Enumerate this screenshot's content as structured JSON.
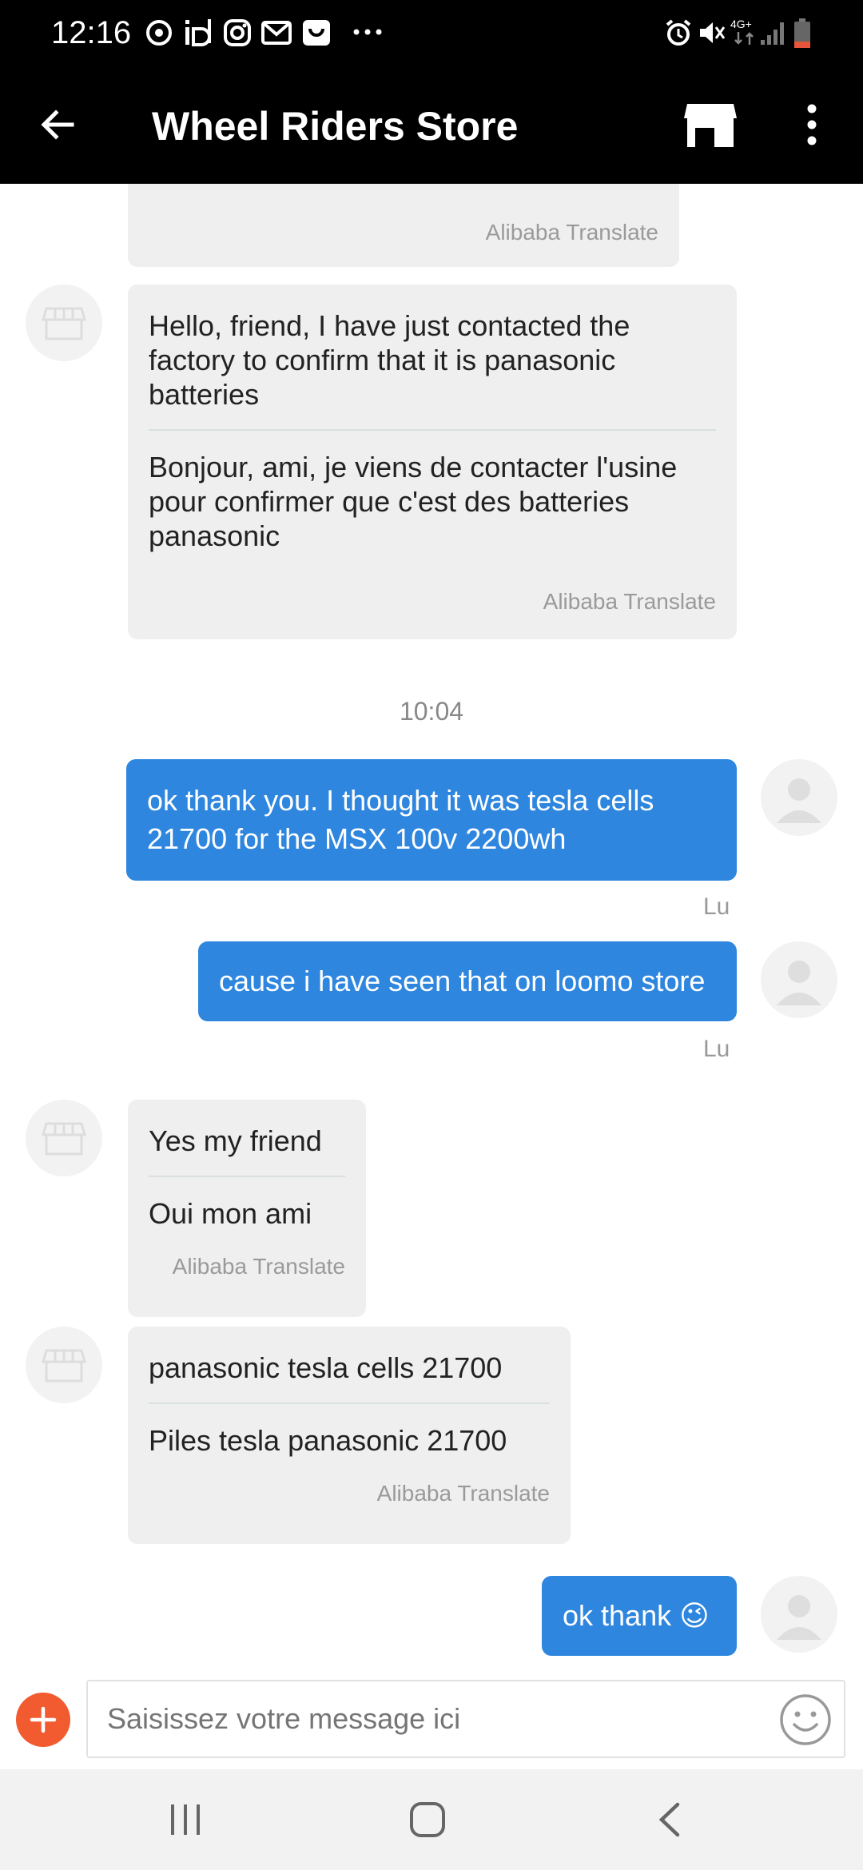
{
  "status_bar": {
    "time": "12:16",
    "left_icons": [
      "sync-icon",
      "id-icon",
      "instagram-icon",
      "gmail-icon",
      "shopping-bag-icon",
      "more-dots-icon"
    ],
    "right_icons": [
      "alarm-icon",
      "mute-icon",
      "network-4g-icon",
      "signal-icon",
      "battery-icon"
    ],
    "network_label": "4G+"
  },
  "header": {
    "title": "Wheel Riders Store",
    "back_icon": "back-arrow-icon",
    "store_icon": "store-icon",
    "menu_icon": "more-vert-icon"
  },
  "messages": [
    {
      "id": "m0",
      "direction": "in",
      "translate_label": "Alibaba Translate"
    },
    {
      "id": "m1",
      "direction": "in",
      "original": "Hello, friend, I have just contacted the factory to confirm that it is panasonic batteries",
      "translation": "Bonjour, ami, je viens de contacter l'usine pour confirmer que c'est des batteries panasonic",
      "translate_label": "Alibaba Translate"
    },
    {
      "id": "t1",
      "type": "time",
      "time": "10:04"
    },
    {
      "id": "m2",
      "direction": "out",
      "text": "ok thank you. I thought it was tesla cells 21700 for the MSX 100v 2200wh",
      "status": "Lu"
    },
    {
      "id": "m3",
      "direction": "out",
      "text": "cause i have seen that on loomo store",
      "status": "Lu"
    },
    {
      "id": "m4",
      "direction": "in",
      "original": "Yes my friend",
      "translation": "Oui mon ami",
      "translate_label": "Alibaba Translate"
    },
    {
      "id": "m5",
      "direction": "in",
      "original": "panasonic tesla cells 21700",
      "translation": "Piles tesla panasonic 21700",
      "translate_label": "Alibaba Translate"
    },
    {
      "id": "m6",
      "direction": "out",
      "text": "ok thank 😉"
    }
  ],
  "input": {
    "placeholder": "Saisissez votre message ici",
    "value": "",
    "add_icon": "plus-icon",
    "emoji_icon": "smiley-icon"
  },
  "nav_bar": {
    "icons": [
      "recent-apps-icon",
      "home-icon",
      "back-icon"
    ]
  },
  "colors": {
    "accent_blue": "#2e86de",
    "add_button": "#f25a2f",
    "incoming_bubble": "#efefef",
    "header_bg": "#000000"
  }
}
